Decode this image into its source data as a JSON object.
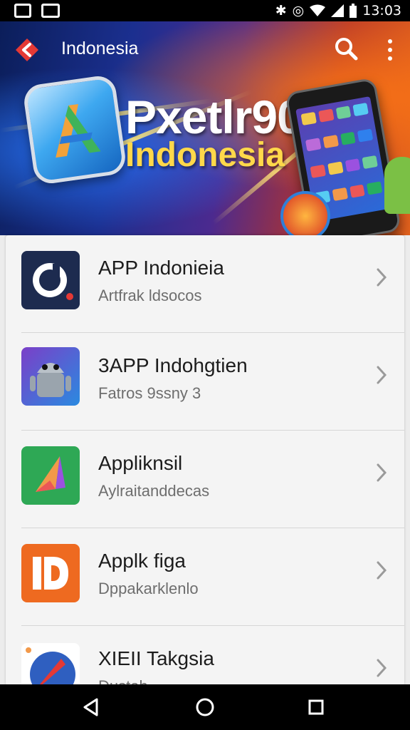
{
  "status_bar": {
    "time": "13:03",
    "icons": [
      "photo-icon",
      "image-icon",
      "bluetooth-icon",
      "alarm-icon",
      "wifi-icon",
      "signal-icon",
      "battery-icon"
    ]
  },
  "header": {
    "title": "Indonesia",
    "hero_line1": "Pxetlr90",
    "hero_line2": "Indonesia",
    "icons": [
      "back-arrow-icon",
      "search-icon",
      "more-vert-icon"
    ]
  },
  "apps": [
    {
      "name": "APP Indonieia",
      "subtitle": "Artfrak ldsocos",
      "icon": "app-logo-navy-icon",
      "color": "#1d2b4f"
    },
    {
      "name": "3APP Indohgtien",
      "subtitle": "Fatros 9ssny 3",
      "icon": "android-robot-icon",
      "color": "#3e5fd0"
    },
    {
      "name": "Appliknsil",
      "subtitle": "Aylraitanddecas",
      "icon": "paper-plane-icon",
      "color": "#2ea855"
    },
    {
      "name": "Applk figa",
      "subtitle": "Dppakarklenlo",
      "icon": "id-logo-icon",
      "color": "#ee6a20"
    },
    {
      "name": "XIEII Takgsia",
      "subtitle": "Dustah",
      "icon": "rocket-icon",
      "color": "#2f5fc0"
    }
  ],
  "nav_bar": {
    "icons": [
      "back-triangle-icon",
      "home-circle-icon",
      "recents-square-icon"
    ]
  },
  "colors": {
    "status_bar": "#000000",
    "list_background": "#f4f4f4",
    "title_text": "#1c1c1c",
    "subtitle_text": "#6e6e6e",
    "header_accent": "#ffd84a"
  }
}
